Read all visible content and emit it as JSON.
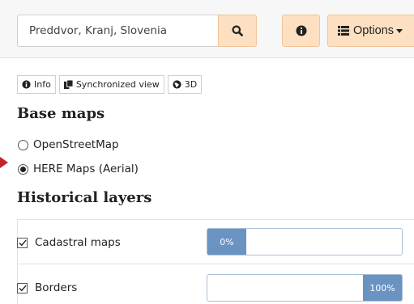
{
  "search": {
    "value": "Preddvor, Kranj, Slovenia"
  },
  "toolbar": {
    "options_label": "Options"
  },
  "tabs": [
    {
      "label": "Info",
      "icon": "info-circle-icon"
    },
    {
      "label": "Synchronized view",
      "icon": "copy-icon"
    },
    {
      "label": "3D",
      "icon": "globe-icon"
    }
  ],
  "base_maps": {
    "heading": "Base maps",
    "options": [
      {
        "label": "OpenStreetMap",
        "selected": false
      },
      {
        "label": "HERE Maps (Aerial)",
        "selected": true
      }
    ]
  },
  "historical_layers": {
    "heading": "Historical layers",
    "layers": [
      {
        "label": "Cadastral maps",
        "checked": true,
        "progress_label": "0%",
        "progress": 0
      },
      {
        "label": "Borders",
        "checked": true,
        "progress_label": "100%",
        "progress": 100
      }
    ]
  },
  "colors": {
    "accent_button": "#fde0c2",
    "progress_fill": "#6a93c2",
    "arrow": "#c0252a"
  }
}
